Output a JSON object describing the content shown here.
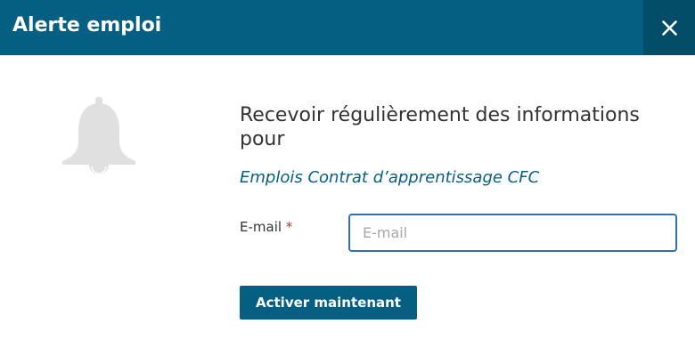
{
  "header": {
    "title": "Alerte emploi",
    "close_icon": "close-icon"
  },
  "icons": {
    "bell": "bell-icon"
  },
  "colors": {
    "header_bg": "#055f82",
    "close_bg": "#044d69",
    "accent": "#055f82",
    "input_focus_border": "#2f6fb7",
    "required": "#c0392b",
    "bell": "#e0e0e0"
  },
  "main": {
    "headline": "Recevoir régulièrement des informations pour",
    "subline": "Emplois Contrat d’apprentissage CFC",
    "email_label": "E-mail",
    "required_marker": "*",
    "email_value": "",
    "email_placeholder": "E-mail",
    "submit_label": "Activer maintenant"
  }
}
